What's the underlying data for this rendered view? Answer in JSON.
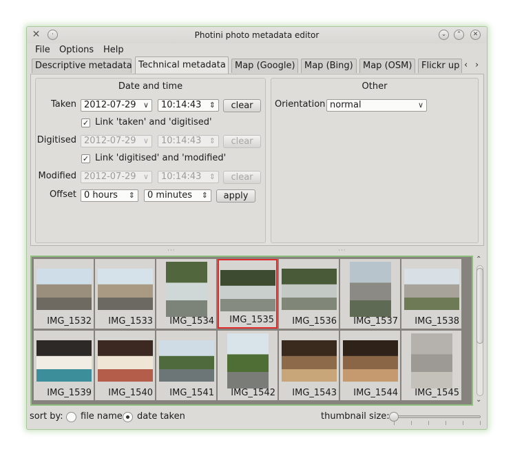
{
  "window": {
    "title": "Photini photo metadata editor"
  },
  "menu": [
    "File",
    "Options",
    "Help"
  ],
  "tabs": [
    {
      "label": "Descriptive metadata",
      "active": false
    },
    {
      "label": "Technical metadata",
      "active": true
    },
    {
      "label": "Map (Google)",
      "active": false
    },
    {
      "label": "Map (Bing)",
      "active": false
    },
    {
      "label": "Map (OSM)",
      "active": false
    },
    {
      "label": "Flickr up",
      "active": false
    }
  ],
  "date_time": {
    "title": "Date and time",
    "taken": {
      "label": "Taken",
      "date": "2012-07-29",
      "time": "10:14:43",
      "clear": "clear"
    },
    "link_taken": "Link 'taken' and 'digitised'",
    "digitised": {
      "label": "Digitised",
      "date": "2012-07-29",
      "time": "10:14:43",
      "clear": "clear"
    },
    "link_digitised": "Link 'digitised' and 'modified'",
    "modified": {
      "label": "Modified",
      "date": "2012-07-29",
      "time": "10:14:43",
      "clear": "clear"
    },
    "offset": {
      "label": "Offset",
      "hours": "0 hours",
      "minutes": "0 minutes",
      "apply": "apply"
    }
  },
  "other": {
    "title": "Other",
    "orientation_label": "Orientation",
    "orientation_value": "normal"
  },
  "images": [
    {
      "name": "IMG_1532",
      "kind": "landscape",
      "colors": [
        "#cfdde8",
        "#9a8f7d",
        "#6e6a62"
      ],
      "selected": false
    },
    {
      "name": "IMG_1533",
      "kind": "landscape",
      "colors": [
        "#d6e2ea",
        "#a89a83",
        "#6b6962"
      ],
      "selected": false
    },
    {
      "name": "IMG_1534",
      "kind": "portrait",
      "colors": [
        "#52663d",
        "#cfd8d6",
        "#7c8378"
      ],
      "selected": false
    },
    {
      "name": "IMG_1535",
      "kind": "landscape",
      "colors": [
        "#3d4b30",
        "#c8cfcc",
        "#858b80"
      ],
      "selected": true
    },
    {
      "name": "IMG_1536",
      "kind": "landscape",
      "colors": [
        "#485a38",
        "#c3cac6",
        "#808779"
      ],
      "selected": false
    },
    {
      "name": "IMG_1537",
      "kind": "portrait",
      "colors": [
        "#b7c4cc",
        "#8c8a84",
        "#5f6a55"
      ],
      "selected": false
    },
    {
      "name": "IMG_1538",
      "kind": "landscape",
      "colors": [
        "#d8e0e6",
        "#a8a39a",
        "#6e7a55"
      ],
      "selected": false
    },
    {
      "name": "IMG_1539",
      "kind": "landscape",
      "colors": [
        "#2d2926",
        "#f1ede4",
        "#3c8f9a"
      ],
      "selected": false
    },
    {
      "name": "IMG_1540",
      "kind": "landscape",
      "colors": [
        "#3c2a22",
        "#efe6d6",
        "#b35d4a"
      ],
      "selected": false
    },
    {
      "name": "IMG_1541",
      "kind": "landscape",
      "colors": [
        "#cfdbe5",
        "#4f6a3c",
        "#6c7676"
      ],
      "selected": false
    },
    {
      "name": "IMG_1542",
      "kind": "portrait",
      "colors": [
        "#d9e3ea",
        "#4f6e35",
        "#7a7c78"
      ],
      "selected": false
    },
    {
      "name": "IMG_1543",
      "kind": "landscape",
      "colors": [
        "#3a2a1e",
        "#8c6a4a",
        "#c9a57a"
      ],
      "selected": false
    },
    {
      "name": "IMG_1544",
      "kind": "landscape",
      "colors": [
        "#2e2219",
        "#8a6646",
        "#c49a6e"
      ],
      "selected": false
    },
    {
      "name": "IMG_1545",
      "kind": "portrait",
      "colors": [
        "#b5b2ad",
        "#9d9994",
        "#c4c0ba"
      ],
      "selected": false
    }
  ],
  "bottom": {
    "sort_label": "sort by:",
    "option_file": "file name",
    "option_date": "date taken",
    "sort_selected": "date taken",
    "thumb_label": "thumbnail size:",
    "thumb_size_fraction": 0.0
  }
}
